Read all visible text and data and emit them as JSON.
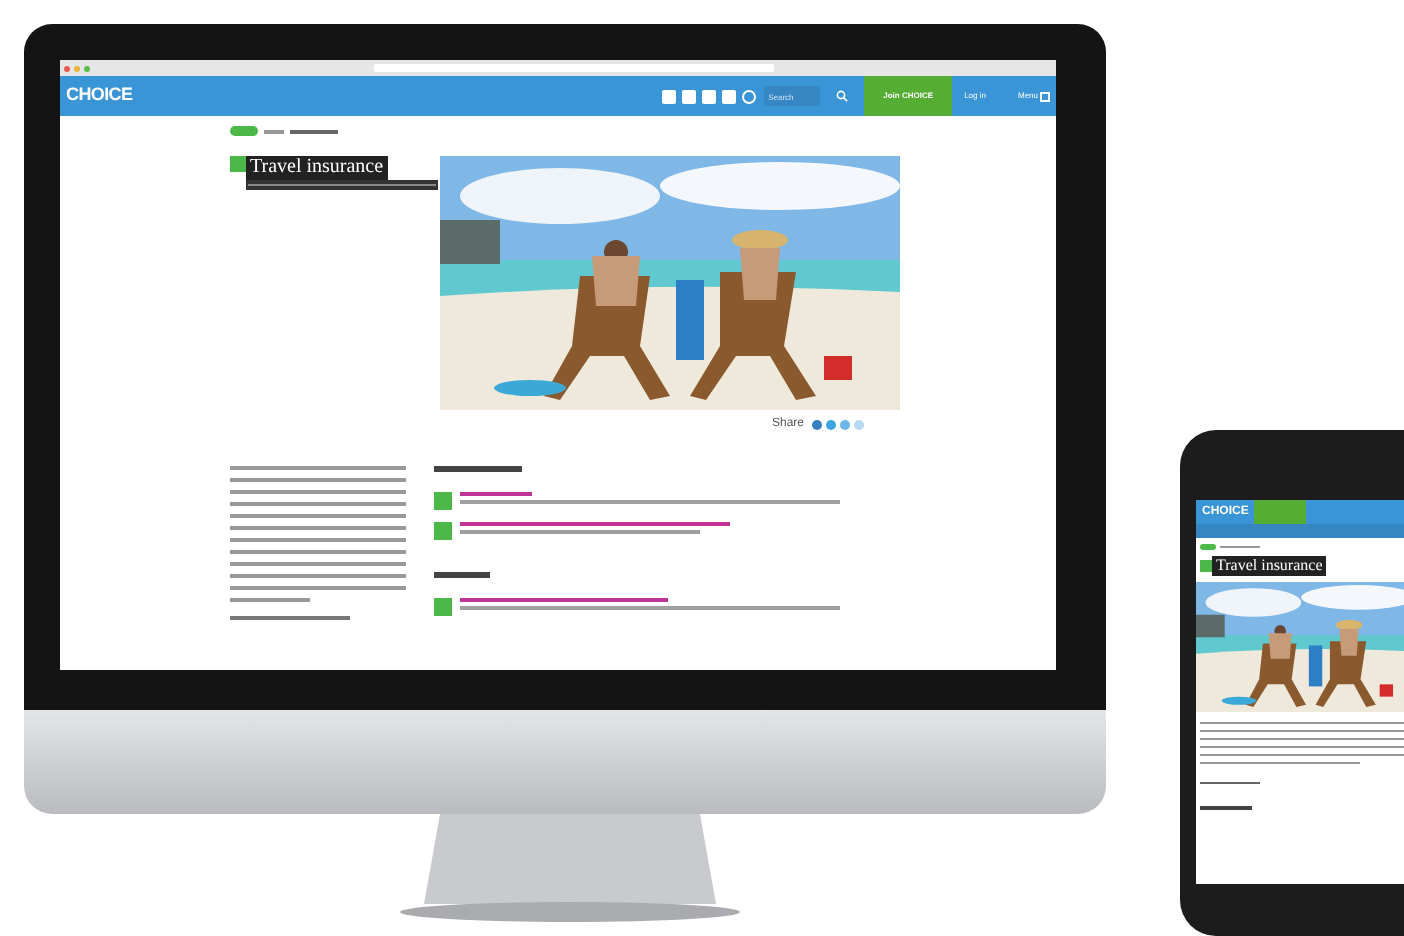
{
  "desktop": {
    "logo": "CHOICE",
    "nav": {
      "search": {
        "placeholder": "Search"
      },
      "join": "Join CHOICE",
      "login": "Log in",
      "menu": "Menu"
    },
    "title": "Travel insurance",
    "share_label": "Share"
  },
  "phone": {
    "logo": "CHOICE",
    "title": "Travel insurance"
  }
}
